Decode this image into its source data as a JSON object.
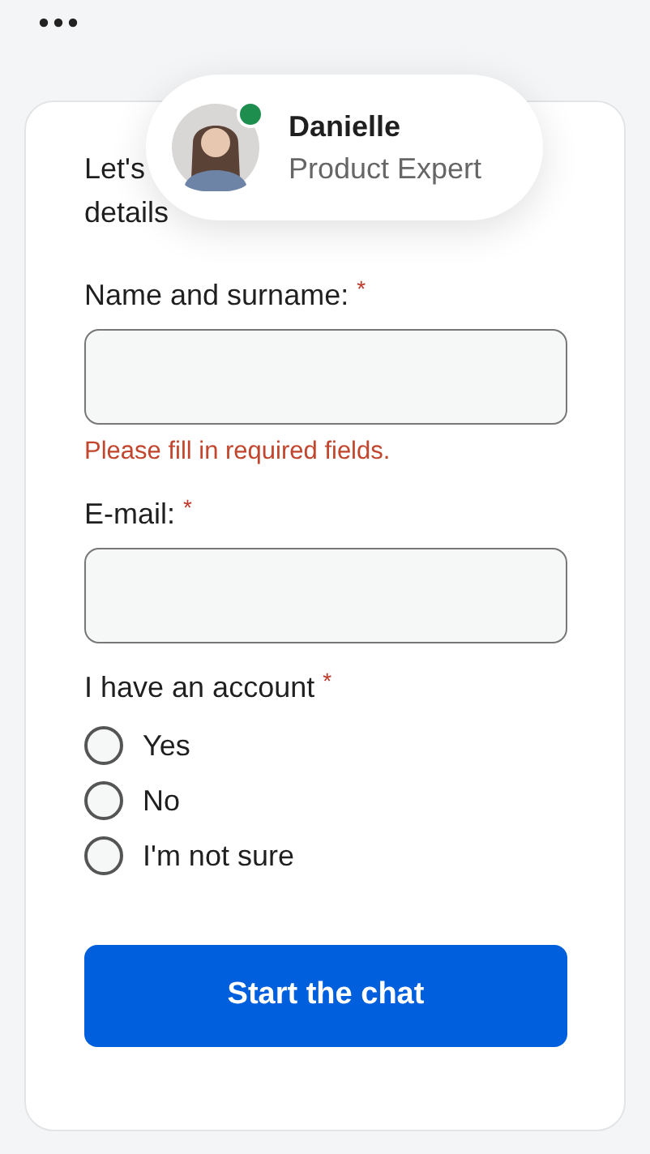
{
  "agent": {
    "name": "Danielle",
    "role": "Product Expert",
    "online": true
  },
  "intro": [
    "Let's",
    "details"
  ],
  "fields": [
    {
      "label": "Name and surname:",
      "required_mark": "*",
      "error": "Please fill in required fields."
    },
    {
      "label": "E-mail:",
      "required_mark": "*"
    }
  ],
  "account": {
    "label": "I have an account",
    "required_mark": "*",
    "options": [
      {
        "label": "Yes",
        "selected": false
      },
      {
        "label": "No",
        "selected": false
      },
      {
        "label": "I'm not sure",
        "selected": false
      }
    ]
  },
  "submit": "Start the chat"
}
